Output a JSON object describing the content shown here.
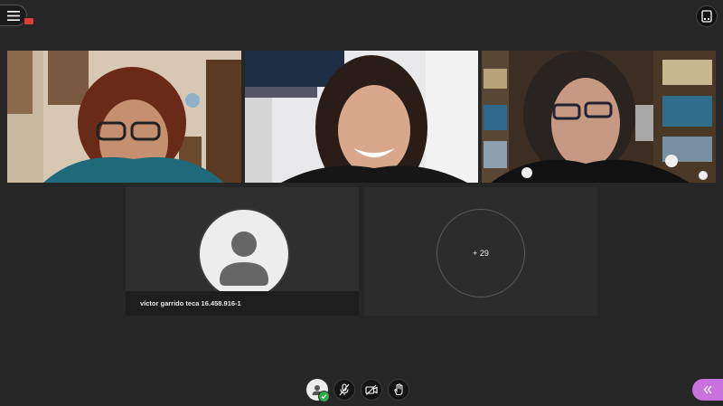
{
  "participants": [
    {
      "id": "p1",
      "type": "video",
      "description_color": "#d9c9b4"
    },
    {
      "id": "p2",
      "type": "video",
      "description_color": "#e8e8ea"
    },
    {
      "id": "p3",
      "type": "video",
      "description_color": "#4a3a2a"
    },
    {
      "id": "p4",
      "type": "avatar",
      "name": "víctor garrido teca 16.458.916-1"
    },
    {
      "id": "more",
      "type": "overflow",
      "label": "+ 29"
    }
  ],
  "colors": {
    "background": "#262626",
    "accent_collab": "#c873e0",
    "recording": "#e23b3b",
    "status_ok": "#2faa49"
  },
  "icons": {
    "menu": "hamburger-icon",
    "switch_view": "tablet-icon",
    "mic": "microphone-muted-icon",
    "camera": "camera-off-icon",
    "hand": "raise-hand-icon",
    "collab": "chevron-double-left-icon"
  }
}
